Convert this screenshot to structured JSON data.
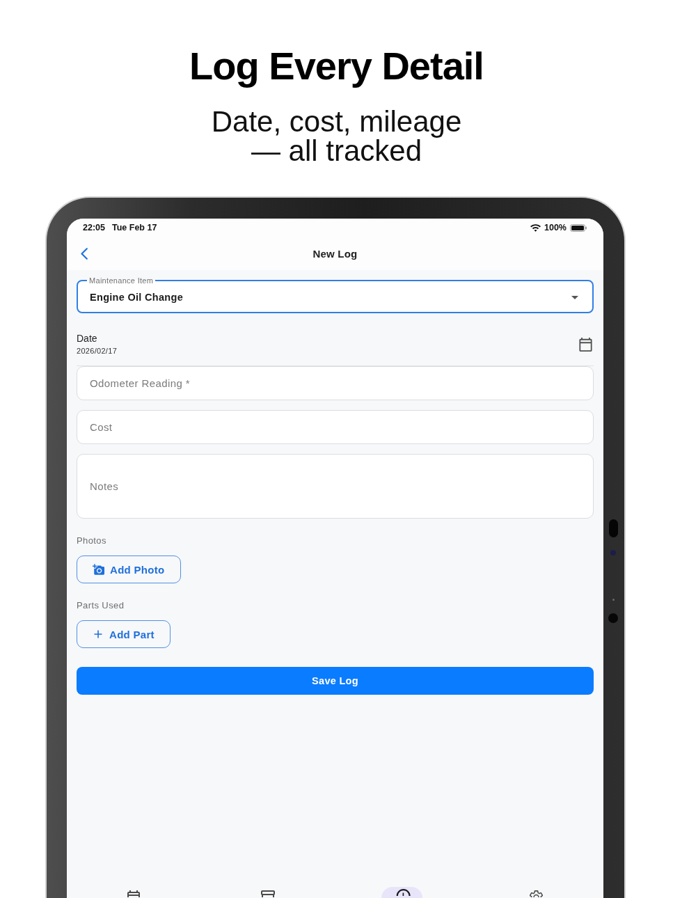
{
  "headline": {
    "title": "Log Every Detail",
    "subtitle": "Date, cost, mileage — all tracked"
  },
  "status_bar": {
    "time": "22:05",
    "date": "Tue Feb 17",
    "battery": "100%"
  },
  "app_bar": {
    "title": "New Log"
  },
  "form": {
    "maintenance_item": {
      "label": "Maintenance Item",
      "value": "Engine Oil Change",
      "focused": true
    },
    "date": {
      "label": "Date",
      "value": "2026/02/17"
    },
    "fields": [
      {
        "kind": "single",
        "placeholder": "Odometer Reading *"
      },
      {
        "kind": "single",
        "placeholder": "Cost"
      },
      {
        "kind": "multiline",
        "placeholder": "Notes"
      }
    ],
    "sections": [
      {
        "kind": "photo",
        "label": "Photos",
        "button": "Add Photo"
      },
      {
        "kind": "part",
        "label": "Parts Used",
        "button": "Add Part"
      }
    ],
    "save_button": "Save Log"
  },
  "nav_items": [
    {
      "kind": "calendar",
      "selected": false
    },
    {
      "kind": "archive",
      "selected": false
    },
    {
      "kind": "history",
      "selected": true
    },
    {
      "kind": "settings",
      "selected": false
    }
  ]
}
